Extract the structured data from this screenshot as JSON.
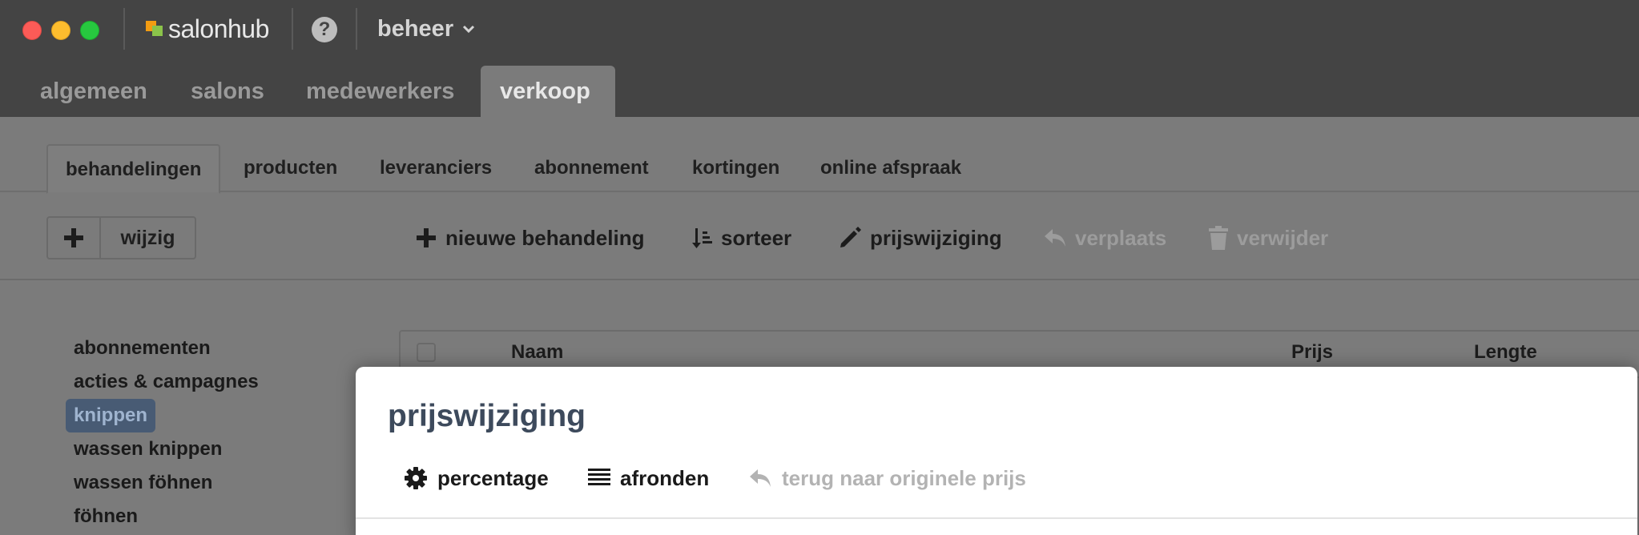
{
  "app": {
    "name": "salonhub",
    "menu": "beheer"
  },
  "top_tabs": [
    {
      "label": "algemeen"
    },
    {
      "label": "salons"
    },
    {
      "label": "medewerkers"
    },
    {
      "label": "verkoop",
      "active": true
    }
  ],
  "sub_tabs": [
    {
      "label": "behandelingen",
      "active": true
    },
    {
      "label": "producten"
    },
    {
      "label": "leveranciers"
    },
    {
      "label": "abonnement"
    },
    {
      "label": "kortingen"
    },
    {
      "label": "online afspraak"
    }
  ],
  "toolbar": {
    "wijzig_label": "wijzig",
    "new_treatment_label": "nieuwe behandeling",
    "sort_label": "sorteer",
    "price_change_label": "prijswijziging",
    "move_label": "verplaats",
    "delete_label": "verwijder"
  },
  "sidebar": {
    "categories": [
      {
        "label": "abonnementen"
      },
      {
        "label": "acties & campagnes"
      },
      {
        "label": "knippen",
        "active": true
      },
      {
        "label": "wassen knippen"
      },
      {
        "label": "wassen föhnen"
      },
      {
        "label": "föhnen"
      }
    ]
  },
  "table": {
    "columns": [
      "Naam",
      "Prijs",
      "Lengte"
    ]
  },
  "modal": {
    "title": "prijswijziging",
    "percentage_label": "percentage",
    "round_label": "afronden",
    "revert_label": "terug naar originele prijs"
  },
  "colors": {
    "titlebar_bg": "#444444",
    "content_bg": "#7b7b7b",
    "active_category_bg": "#485b74",
    "modal_title": "#3d4a5c",
    "logo_orange": "#f39c12",
    "logo_green": "#8bc34a"
  },
  "icons": {
    "help": "question-circle-icon",
    "menu_chevron": "chevron-down-icon",
    "add": "plus-icon",
    "sort": "sort-icon",
    "edit": "pencil-icon",
    "move": "reply-arrow-icon",
    "delete": "trash-icon",
    "percentage": "gear-icon",
    "round": "list-icon",
    "revert": "reply-arrow-icon"
  }
}
